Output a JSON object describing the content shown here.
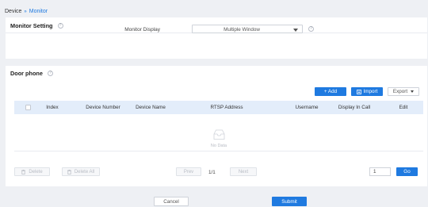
{
  "breadcrumb": {
    "root": "Device",
    "separator": "»",
    "current": "Monitor"
  },
  "monitor_setting": {
    "title": "Monitor Setting",
    "display_label": "Monitor Display",
    "display_value": "Multiple Window"
  },
  "door_phone": {
    "title": "Door phone",
    "add_label": "+ Add",
    "import_label": "Import",
    "export_label": "Export",
    "columns": [
      "Index",
      "Device Number",
      "Device Name",
      "RTSP Address",
      "Username",
      "Display In Call",
      "Edit"
    ],
    "empty_text": "No Data",
    "delete_label": "Delete",
    "delete_all_label": "Delete All",
    "prev_label": "Prev",
    "page_info": "1/1",
    "next_label": "Next",
    "goto_value": "1",
    "go_label": "Go"
  },
  "footer": {
    "cancel_label": "Cancel",
    "submit_label": "Submit"
  },
  "colors": {
    "accent": "#1f7ae0",
    "table_header": "#e3edfa",
    "background": "#eef0f4"
  }
}
